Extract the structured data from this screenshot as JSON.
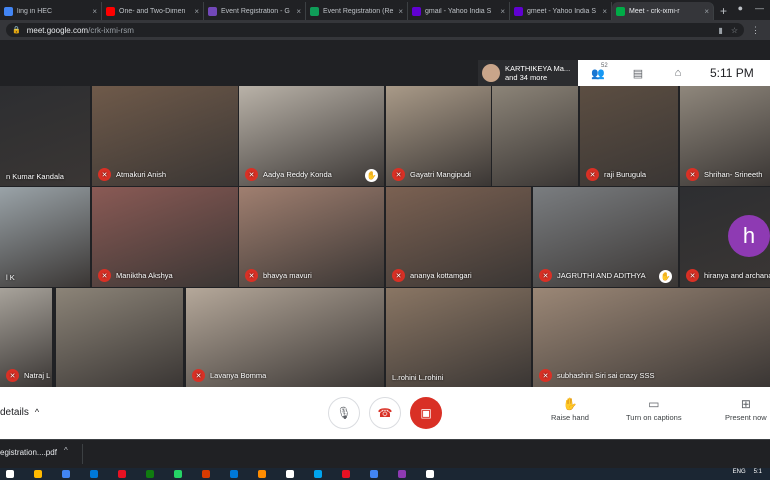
{
  "browser": {
    "tabs": [
      {
        "title": "ling in HEC",
        "color": "#4285f4"
      },
      {
        "title": "One- and Two-Dimen",
        "color": "#ff0000"
      },
      {
        "title": "Event Registration - G",
        "color": "#7248b9"
      },
      {
        "title": "Event Registration (Re",
        "color": "#0f9d58"
      },
      {
        "title": "gmail - Yahoo India S",
        "color": "#6001d2"
      },
      {
        "title": "gmeet - Yahoo India S",
        "color": "#6001d2"
      },
      {
        "title": "Meet - crk-ixmi-r",
        "color": "#00ac47",
        "active": true
      }
    ],
    "tab_close": "×",
    "new_tab": "+",
    "url_host": "meet.google.com",
    "url_path": "/crk-ixmi-rsm",
    "menu_glyph": "⋮"
  },
  "meet": {
    "presenter_chip": {
      "name": "KARTHIKEYA Ma...",
      "more": "and 34 more"
    },
    "people_count": "52",
    "time": "5:11 PM",
    "tiles": [
      {
        "name": "n Kumar Kandala",
        "muted": false,
        "bg": "#2d2e31"
      },
      {
        "name": "Atmakuri Anish",
        "muted": true,
        "bg": "#6f5a4a"
      },
      {
        "name": "Aadya Reddy Konda",
        "muted": true,
        "hand": true,
        "bg": "#b9b2a8"
      },
      {
        "name": "Gayatri Mangipudi",
        "muted": true,
        "bg": "#a99a88"
      },
      {
        "name": "raji Burugula",
        "muted": true,
        "bg": "#5c4e42"
      },
      {
        "name": "Shrihan- Srineeth",
        "muted": true,
        "bg": "#8f877c"
      },
      {
        "name": "l K",
        "muted": false,
        "bg": "#9aa3a8"
      },
      {
        "name": "Maniktha Akshya",
        "muted": true,
        "bg": "#8a5a55"
      },
      {
        "name": "bhavya mavuri",
        "muted": true,
        "bg": "#a07f70"
      },
      {
        "name": "ananya kottamgari",
        "muted": true,
        "bg": "#7b6152"
      },
      {
        "name": "JAGRUTHI AND ADITHYA",
        "muted": true,
        "hand": true,
        "bg": "#7a7d80"
      },
      {
        "name": "hiranya and archana",
        "muted": true,
        "bg": "#2d2e31"
      },
      {
        "name": "Natraj L",
        "muted": true,
        "bg": "#a8a39b"
      },
      {
        "name": "Lavanya Bomma",
        "muted": true,
        "bg": "#b5a89a"
      },
      {
        "name": "L.rohini L.rohini",
        "muted": false,
        "bg": "#8a7664"
      },
      {
        "name": "subhashini Siri sai crazy SSS",
        "muted": true,
        "bg": "#9b8776"
      }
    ],
    "avatar_letter": "h",
    "details_label": "details",
    "actions": [
      {
        "label": "Raise hand"
      },
      {
        "label": "Turn on captions"
      },
      {
        "label": "Present now"
      }
    ]
  },
  "downloads": {
    "file": "egistration....pdf"
  },
  "taskbar": {
    "lang": "ENG",
    "time": "5:1"
  },
  "colors": {
    "accent_red": "#d93025",
    "avatar_purple": "#8e3ab3"
  }
}
